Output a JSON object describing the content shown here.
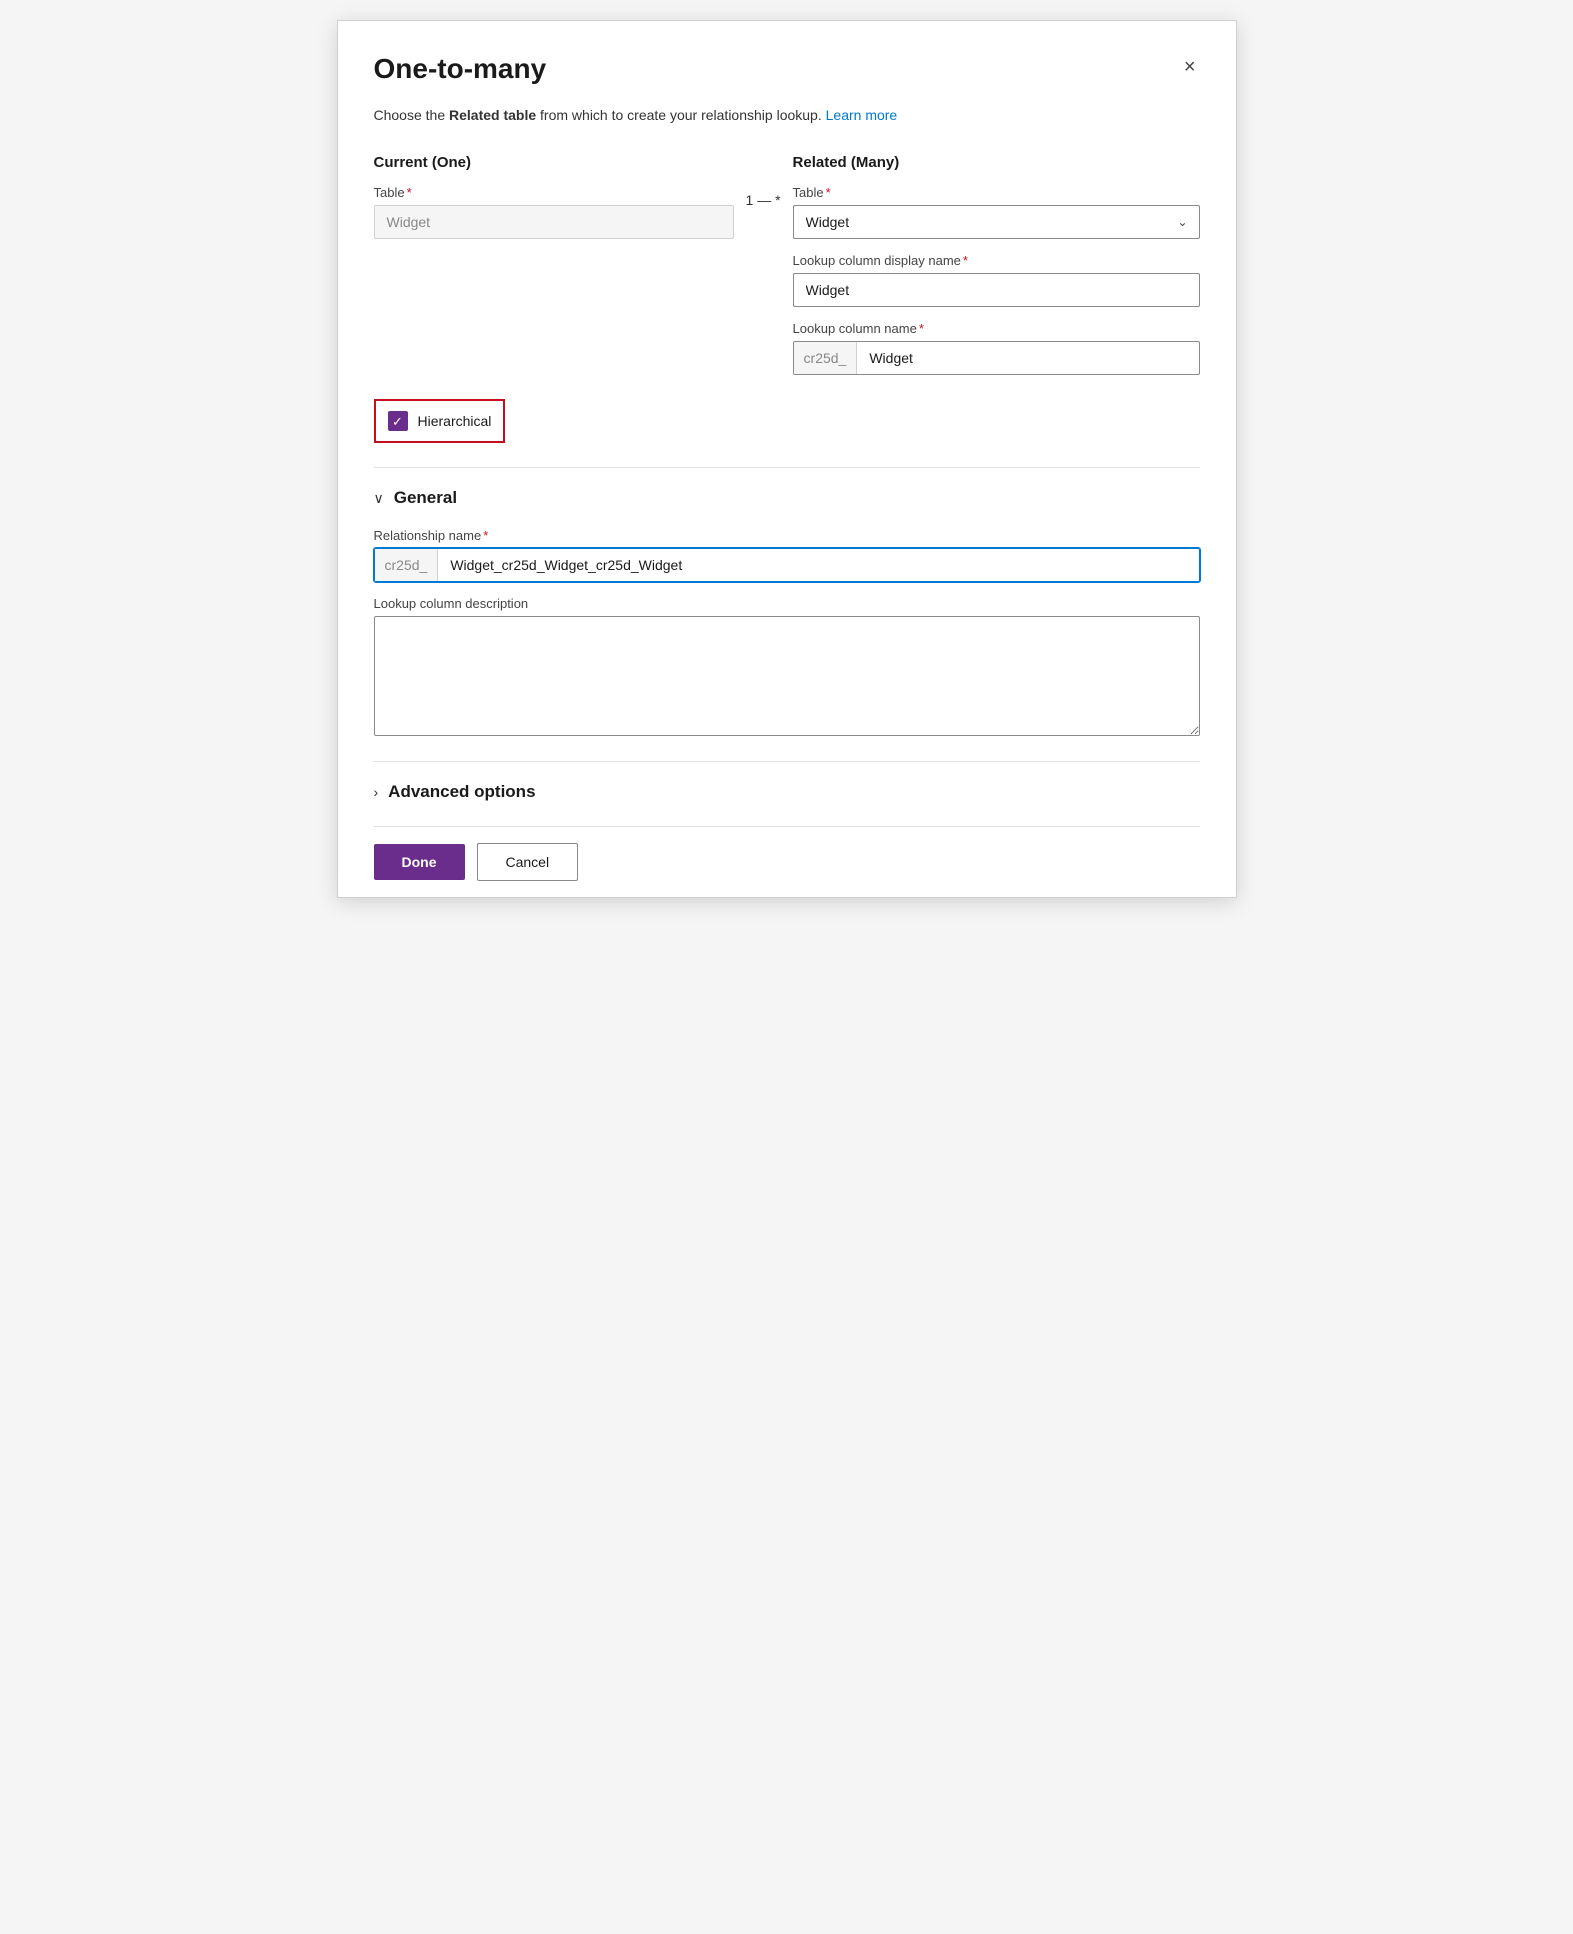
{
  "dialog": {
    "title": "One-to-many",
    "description_text": "Choose the ",
    "description_bold": "Related table",
    "description_text2": " from which to create your relationship lookup. ",
    "learn_more_label": "Learn more",
    "close_icon": "×"
  },
  "current_column": {
    "label": "Current (One)",
    "table_label": "Table",
    "required_marker": "*",
    "table_value": "Widget",
    "connector_left": "1",
    "connector_dash": "—",
    "connector_right": "*"
  },
  "related_column": {
    "label": "Related (Many)",
    "table_label": "Table",
    "required_marker": "*",
    "table_value": "Widget",
    "lookup_display_label": "Lookup column display name",
    "lookup_display_value": "Widget",
    "lookup_name_label": "Lookup column name",
    "lookup_name_prefix": "cr25d_",
    "lookup_name_value": "Widget"
  },
  "hierarchical": {
    "label": "Hierarchical",
    "checked": true
  },
  "general_section": {
    "toggle_icon": "∨",
    "label": "General",
    "relationship_name_label": "Relationship name",
    "required_marker": "*",
    "relationship_name_prefix": "cr25d_",
    "relationship_name_value": "Widget_cr25d_Widget_cr25d_Widget",
    "description_label": "Lookup column description",
    "description_value": ""
  },
  "advanced_section": {
    "toggle_icon": "›",
    "label": "Advanced options"
  },
  "footer": {
    "done_label": "Done",
    "cancel_label": "Cancel"
  }
}
